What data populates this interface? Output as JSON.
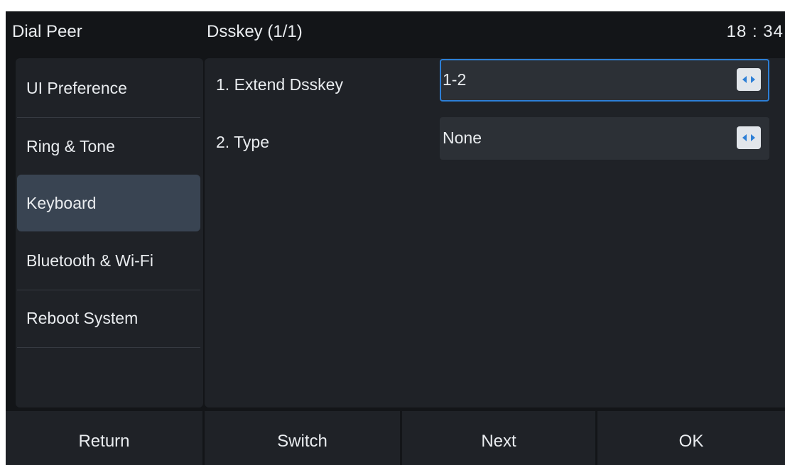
{
  "header": {
    "app_title": "Dial Peer",
    "page_title": "Dsskey (1/1)",
    "clock": "18 : 34"
  },
  "sidebar": {
    "items": [
      {
        "label": "UI Preference"
      },
      {
        "label": "Ring & Tone"
      },
      {
        "label": "Keyboard",
        "selected": true
      },
      {
        "label": "Bluetooth & Wi-Fi"
      },
      {
        "label": "Reboot System"
      }
    ]
  },
  "form": {
    "rows": [
      {
        "label": "1. Extend Dsskey",
        "value": "1-2",
        "focused": true
      },
      {
        "label": "2. Type",
        "value": "None"
      }
    ]
  },
  "softkeys": {
    "return_label": "Return",
    "switch_label": "Switch",
    "next_label": "Next",
    "ok_label": "OK"
  },
  "colors": {
    "background": "#131518",
    "panel": "#1f2227",
    "selected_item": "#394452",
    "focus_border": "#2d7fd6",
    "arrow_icon": "#2d7fd6"
  }
}
